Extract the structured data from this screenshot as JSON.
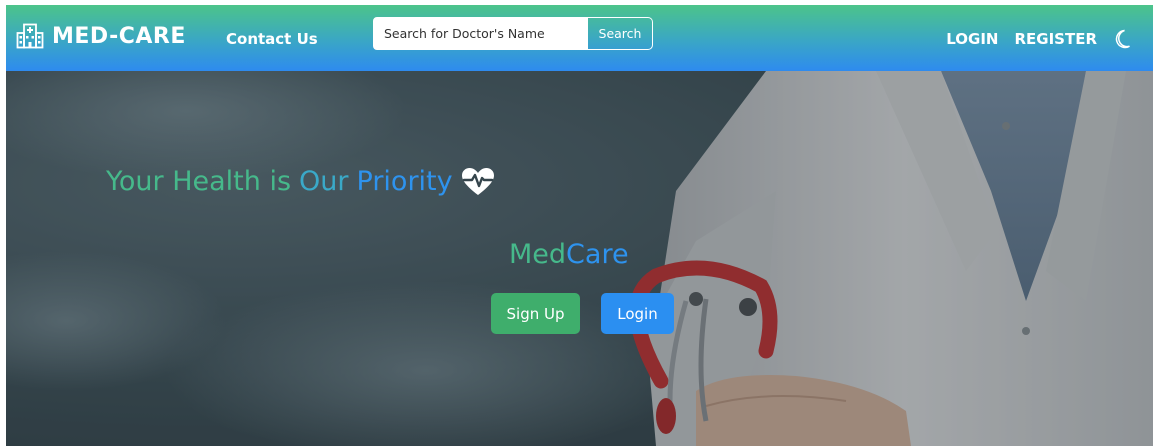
{
  "navbar": {
    "brand": "MED-CARE",
    "contact": "Contact Us",
    "search_placeholder": "Search for Doctor's Name",
    "search_button": "Search",
    "login": "LOGIN",
    "register": "REGISTER",
    "icons": {
      "brand": "hospital-icon",
      "theme": "moon-icon"
    }
  },
  "hero": {
    "tagline_part1": "Your Health is",
    "tagline_part2": "Our",
    "tagline_part3": "Priority",
    "heart_icon": "heartbeat-icon",
    "brand_med": "Med",
    "brand_care": "Care",
    "signup_button": "Sign Up",
    "login_button": "Login"
  },
  "colors": {
    "green": "#46b98b",
    "blue": "#2e93ee",
    "signup": "#3fae6c",
    "login": "#2b8ff1"
  }
}
